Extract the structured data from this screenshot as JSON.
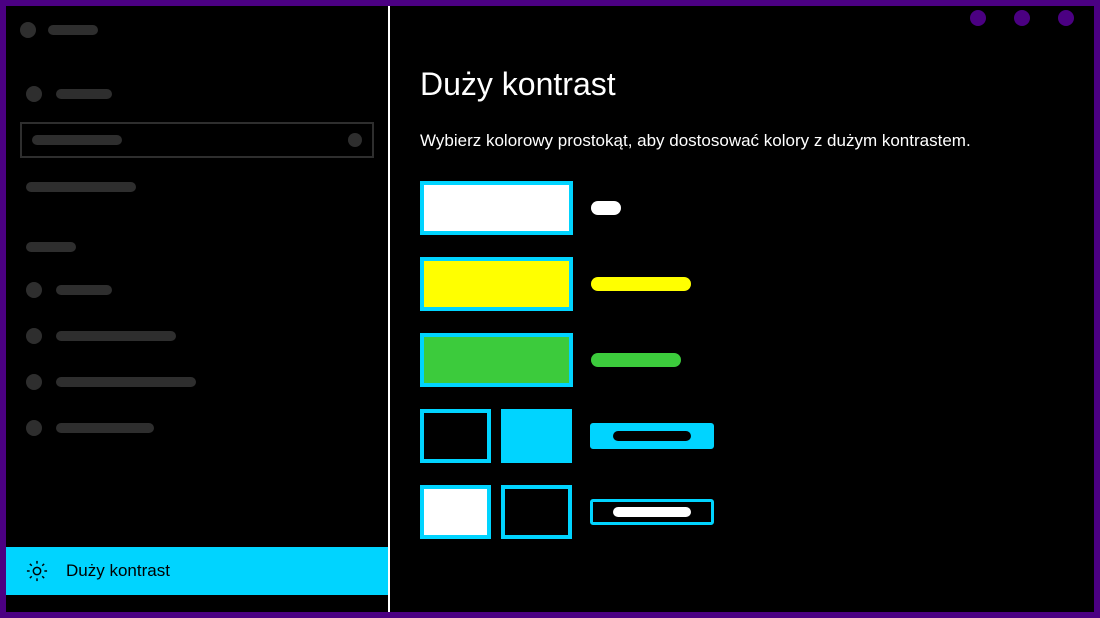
{
  "page": {
    "title": "Duży kontrast",
    "subtitle": "Wybierz kolorowy prostokąt, aby dostosować kolory z dużym kontrastem."
  },
  "sidebar": {
    "active_item_label": "Duży kontrast"
  },
  "colors": {
    "accent": "#00D4FF",
    "frame": "#4B0082",
    "swatches": [
      {
        "fill": "#FFFFFF",
        "label_color": "#FFFFFF"
      },
      {
        "fill": "#FFFF00",
        "label_color": "#FFFF00"
      },
      {
        "fill": "#3CCB3C",
        "label_color": "#3CCB3C"
      }
    ],
    "selected_row": {
      "left_fill": "#000000",
      "right_fill": "#00D4FF",
      "button_bg": "#00D4FF",
      "button_text_color": "#000000"
    },
    "button_row": {
      "left_fill": "#FFFFFF",
      "right_fill": "#000000",
      "button_bg": "#000000",
      "button_text_color": "#FFFFFF"
    }
  }
}
